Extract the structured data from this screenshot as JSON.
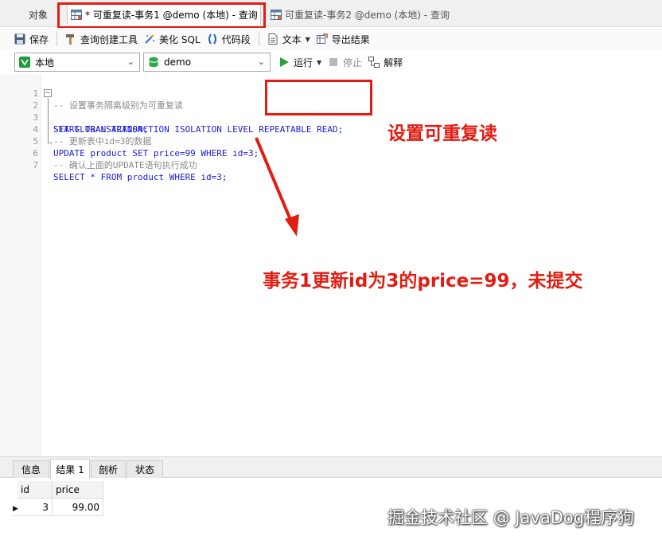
{
  "tabs": {
    "objects": "对象",
    "active": "* 可重复读-事务1 @demo (本地) - 查询",
    "second": "可重复读-事务2 @demo (本地) - 查询"
  },
  "toolbar1": {
    "save": "保存",
    "query_builder": "查询创建工具",
    "beautify": "美化 SQL",
    "snippet": "代码段",
    "text": "文本",
    "export": "导出结果"
  },
  "toolbar2": {
    "connection": "本地",
    "database": "demo",
    "run": "运行",
    "stop": "停止",
    "explain": "解释"
  },
  "editor": {
    "lines": [
      {
        "num": "1",
        "text": "-- 设置事务隔离级别为可重复读"
      },
      {
        "num": "2",
        "text": "SET GLOBAL TRANSACTION ISOLATION LEVEL REPEATABLE READ;"
      },
      {
        "num": "3",
        "text": "START TRANSACTION;"
      },
      {
        "num": "4",
        "text": "-- 更新表中id=3的数据"
      },
      {
        "num": "5",
        "text": "UPDATE product SET price=99 WHERE id=3;"
      },
      {
        "num": "6",
        "text": "-- 确认上面的UPDATE语句执行成功"
      },
      {
        "num": "7",
        "text": "SELECT * FROM product WHERE id=3;"
      }
    ]
  },
  "annotations": {
    "isolation": "设置可重复读",
    "update": "事务1更新id为3的price=99，未提交",
    "color": "#e11d12"
  },
  "results": {
    "tabs": [
      "信息",
      "结果 1",
      "剖析",
      "状态"
    ],
    "active_tab": "结果 1",
    "columns": [
      "id",
      "price"
    ],
    "rows": [
      [
        "3",
        "99.00"
      ]
    ]
  },
  "watermark": "掘金技术社区 @ JavaDog程序狗"
}
